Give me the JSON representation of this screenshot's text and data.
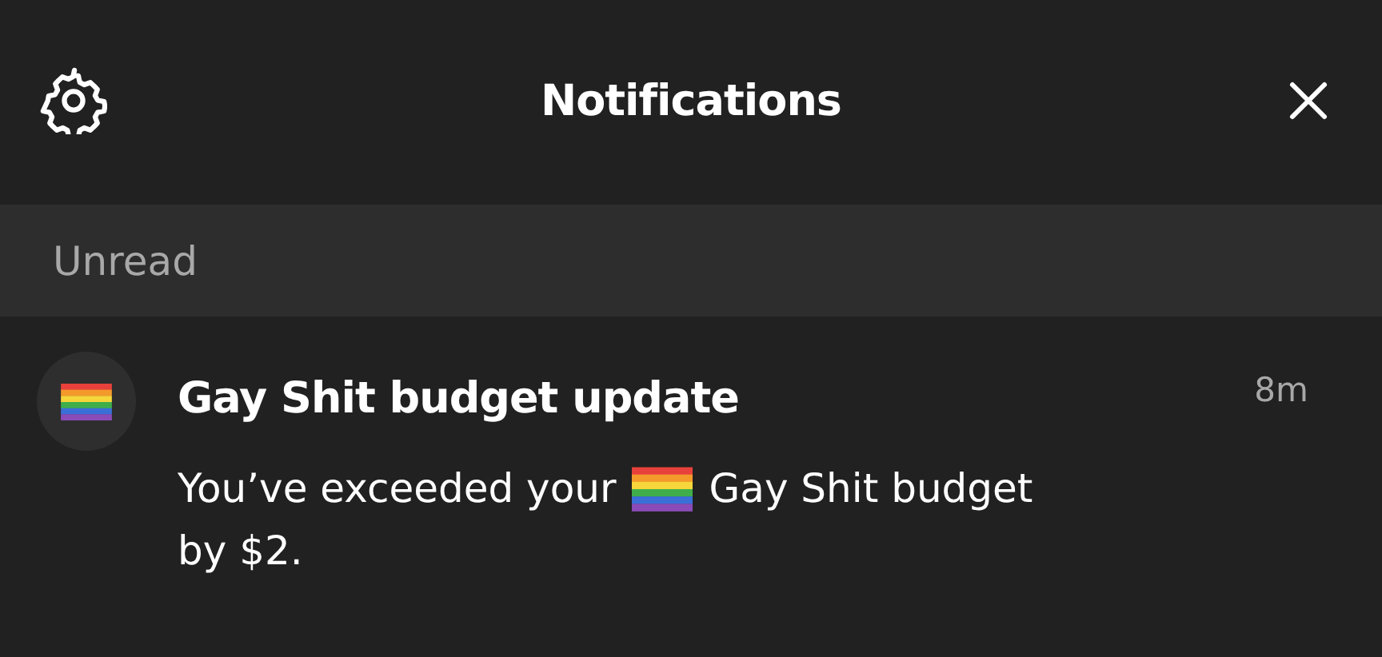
{
  "header": {
    "title": "Notifications"
  },
  "section": {
    "title": "Unread"
  },
  "notifications": [
    {
      "title": "Gay Shit budget update",
      "time": "8m",
      "message_before": "You’ve exceeded your",
      "message_after": "Gay Shit budget",
      "message_end": "by $2."
    }
  ]
}
